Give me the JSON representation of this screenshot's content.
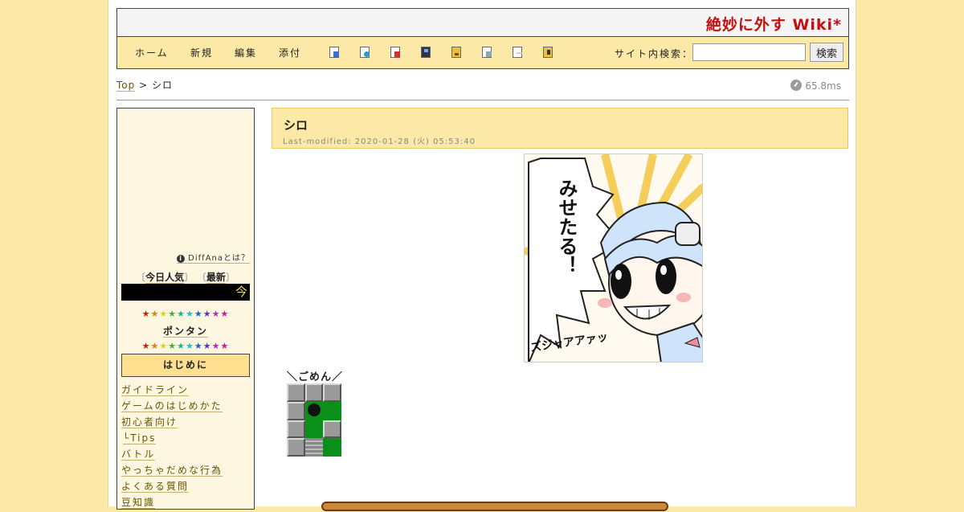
{
  "header": {
    "site_title": "絶妙に外す Wiki*"
  },
  "nav": {
    "items": [
      "ホーム",
      "新規",
      "編集",
      "添付"
    ],
    "tool_icons": [
      "diff-icon",
      "backup-icon",
      "delete-icon",
      "save-icon",
      "lock-icon",
      "copy-icon",
      "list-icon",
      "help-icon"
    ],
    "search_label": "サイト内検索：",
    "search_value": "",
    "search_button": "検索"
  },
  "breadcrumb": {
    "top": "Top",
    "sep": ">",
    "current": "シロ"
  },
  "timing": "65.8ms",
  "sidebar": {
    "diffana": "DiffAnaとは？",
    "rank_today": "今日人気",
    "rank_latest": "最新",
    "today_glyph": "今",
    "star": "★",
    "pontan": "ポンタン",
    "section": "はじめに",
    "menu": [
      "ガイドライン",
      "ゲームのはじめかた",
      "初心者向け",
      "└Tips",
      "バトル",
      "やっちゃだめな行為",
      "よくある質問",
      "豆知識"
    ]
  },
  "main": {
    "title": "シロ",
    "last_modified": "Last-modified: 2020-01-28 (火) 05:53:40",
    "manga_text": "みせたる！",
    "manga_sfx": "ズジャアアァッ",
    "caption": "＼ごめん／"
  }
}
